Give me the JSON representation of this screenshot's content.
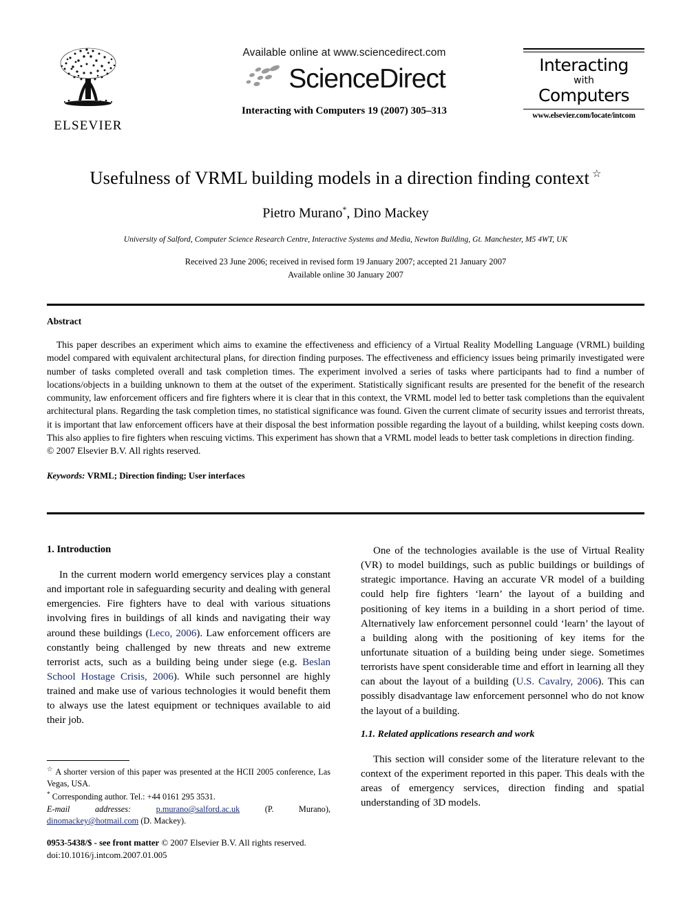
{
  "header": {
    "publisher_name": "ELSEVIER",
    "publisher_logo_icon": "elsevier-tree-logo",
    "available_online": "Available online at www.sciencedirect.com",
    "sciencedirect_wordmark": "ScienceDirect",
    "sciencedirect_logo_icon": "sciencedirect-swoosh-icon",
    "journal_citation_line": "Interacting with Computers 19 (2007) 305–313",
    "masthead": {
      "line1": "Interacting",
      "line2": "with",
      "line3": "Computers",
      "url": "www.elsevier.com/locate/intcom"
    }
  },
  "title_block": {
    "title": "Usefulness of VRML building models in a direction finding context",
    "title_footnote_marker": "☆",
    "authors": "Pietro Murano",
    "author_footnote_marker": "*",
    "authors_rest": ", Dino Mackey",
    "affiliation": "University of Salford, Computer Science Research Centre, Interactive Systems and Media, Newton Building, Gt. Manchester, M5 4WT, UK",
    "received_line": "Received 23 June 2006; received in revised form 19 January 2007; accepted 21 January 2007",
    "available_line": "Available online 30 January 2007"
  },
  "abstract": {
    "heading": "Abstract",
    "body": "This paper describes an experiment which aims to examine the effectiveness and efficiency of a Virtual Reality Modelling Language (VRML) building model compared with equivalent architectural plans, for direction finding purposes. The effectiveness and efficiency issues being primarily investigated were number of tasks completed overall and task completion times. The experiment involved a series of tasks where participants had to find a number of locations/objects in a building unknown to them at the outset of the experiment. Statistically significant results are presented for the benefit of the research community, law enforcement officers and fire fighters where it is clear that in this context, the VRML model led to better task completions than the equivalent architectural plans. Regarding the task completion times, no statistical significance was found. Given the current climate of security issues and terrorist threats, it is important that law enforcement officers have at their disposal the best information possible regarding the layout of a building, whilst keeping costs down. This also applies to fire fighters when rescuing victims. This experiment has shown that a VRML model leads to better task completions in direction finding.",
    "copyright": "© 2007 Elsevier B.V. All rights reserved.",
    "keywords_label": "Keywords:",
    "keywords_values": "VRML; Direction finding; User interfaces"
  },
  "body": {
    "left_column": {
      "section_heading": "1. Introduction",
      "paragraph_1_part1": "In the current modern world emergency services play a constant and important role in safeguarding security and dealing with general emergencies. Fire fighters have to deal with various situations involving fires in buildings of all kinds and navigating their way around these buildings (",
      "citation_1": "Leco, 2006",
      "paragraph_1_part2": "). Law enforcement officers are constantly being challenged by new threats and new extreme terrorist acts, such as a building being under siege (e.g. ",
      "citation_2": "Beslan School Hostage Crisis, 2006",
      "paragraph_1_part3": "). While such personnel are highly trained and make use of various technologies it would benefit them to always use the latest equipment or techniques available to aid their job."
    },
    "right_column": {
      "paragraph_1_part1": "One of the technologies available is the use of Virtual Reality (VR) to model buildings, such as public buildings or buildings of strategic importance. Having an accurate VR model of a building could help fire fighters ‘learn’ the layout of a building and positioning of key items in a building in a short period of time. Alternatively law enforcement personnel could ‘learn’ the layout of a building along with the positioning of key items for the unfortunate situation of a building being under siege. Sometimes terrorists have spent considerable time and effort in learning all they can about the layout of a building (",
      "citation_1": "U.S. Cavalry, 2006",
      "paragraph_1_part2": "). This can possibly disadvantage law enforcement personnel who do not know the layout of a building.",
      "subsection_heading": "1.1. Related applications research and work",
      "paragraph_2": "This section will consider some of the literature relevant to the context of the experiment reported in this paper. This deals with the areas of emergency services, direction finding and spatial understanding of 3D models."
    }
  },
  "footnotes": {
    "star_marker": "☆",
    "star_text": "A shorter version of this paper was presented at the HCII 2005 conference, Las Vegas, USA.",
    "corresponding_marker": "*",
    "corresponding_text": "Corresponding author. Tel.: +44 0161 295 3531.",
    "email_label": "E-mail addresses:",
    "email_1": "p.murano@salford.ac.uk",
    "email_1_owner": "(P. Murano),",
    "email_2": "dinomackey@hotmail.com",
    "email_2_owner": "(D. Mackey)."
  },
  "imprint": {
    "front_matter": "0953-5438/$ - see front matter",
    "copyright": "© 2007 Elsevier B.V. All rights reserved.",
    "doi": "doi:10.1016/j.intcom.2007.01.005"
  },
  "colors": {
    "text": "#000000",
    "citation_link": "#1a2a70",
    "page_background": "#ffffff"
  }
}
